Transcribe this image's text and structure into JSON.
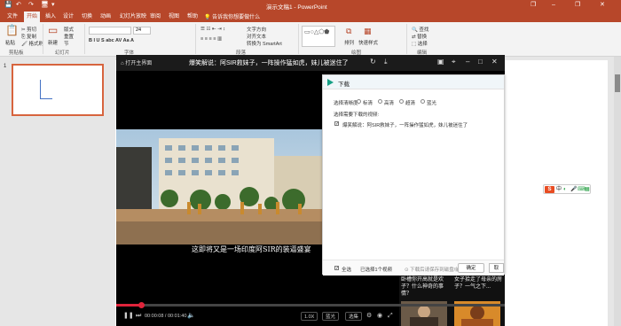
{
  "window": {
    "title": "演示文稿1 - PowerPoint",
    "quick_access": [
      "💾",
      "↶",
      "↷",
      "🖥",
      "▾"
    ],
    "controls": [
      "❐",
      "–",
      "❐",
      "✕"
    ]
  },
  "ribbon": {
    "tabs": [
      "文件",
      "开始",
      "插入",
      "设计",
      "切换",
      "动画",
      "幻灯片放映",
      "审阅",
      "视图",
      "帮助"
    ],
    "active_tab": "开始",
    "tell_me": "告诉我你想要做什么",
    "groups": {
      "clipboard": {
        "paste": "粘贴",
        "cut": "剪切",
        "copy": "复制",
        "format": "格式刷",
        "label": "剪贴板"
      },
      "slides": {
        "new": "新建",
        "layout": "版式",
        "reset": "重置",
        "section": "节",
        "label": "幻灯片"
      },
      "font": {
        "font_size": "24",
        "label": "字体"
      },
      "paragraph": {
        "text_direction": "文字方向",
        "align_text": "对齐文本",
        "smartart": "转换为 SmartArt",
        "label": "段落"
      },
      "drawing": {
        "arrange": "排列",
        "quick_styles": "快速样式",
        "label": "绘图"
      },
      "editing": {
        "find": "查找",
        "replace": "替换",
        "select": "选择",
        "label": "编辑"
      }
    }
  },
  "slides_panel": {
    "slide_number": "1"
  },
  "player": {
    "home": "打开主界面",
    "title": "爆笑解说：阿SIR救妹子，一阵操作猛如虎，妹儿被迷住了",
    "subtitle": "这即将又是一场印度阿SIR的装逼盛宴",
    "progress_fraction": 0.065,
    "time": "00:00:08 / 00:01:40",
    "speed": "1.0X",
    "quality": "蓝光",
    "episodes": "选集",
    "recommendations": [
      {
        "title": "卧槽你开高就是欢子？什么神奇的事情？"
      },
      {
        "title": "女子拾走了母亲的房子？一气之下..."
      }
    ]
  },
  "download_dialog": {
    "title": "下载",
    "quality_label": "选择清晰度:",
    "quality_options": [
      "标清",
      "高清",
      "超清",
      "蓝光"
    ],
    "videos_label": "选择需要下载的视频:",
    "video_item": "爆笑解说：阿SIR救妹子，一阵操作猛如虎，妹儿被迷住了",
    "select_all": "全选",
    "selected_count": "已选择1个视频",
    "save_path": "下载后请保存到磁盘/前",
    "confirm": "确定",
    "cancel": "取"
  },
  "ime": {
    "logo": "S",
    "mode": "中"
  },
  "colors": {
    "ppt_brand": "#b7472a",
    "progress": "#e0243b",
    "download_accent": "#16a085"
  }
}
